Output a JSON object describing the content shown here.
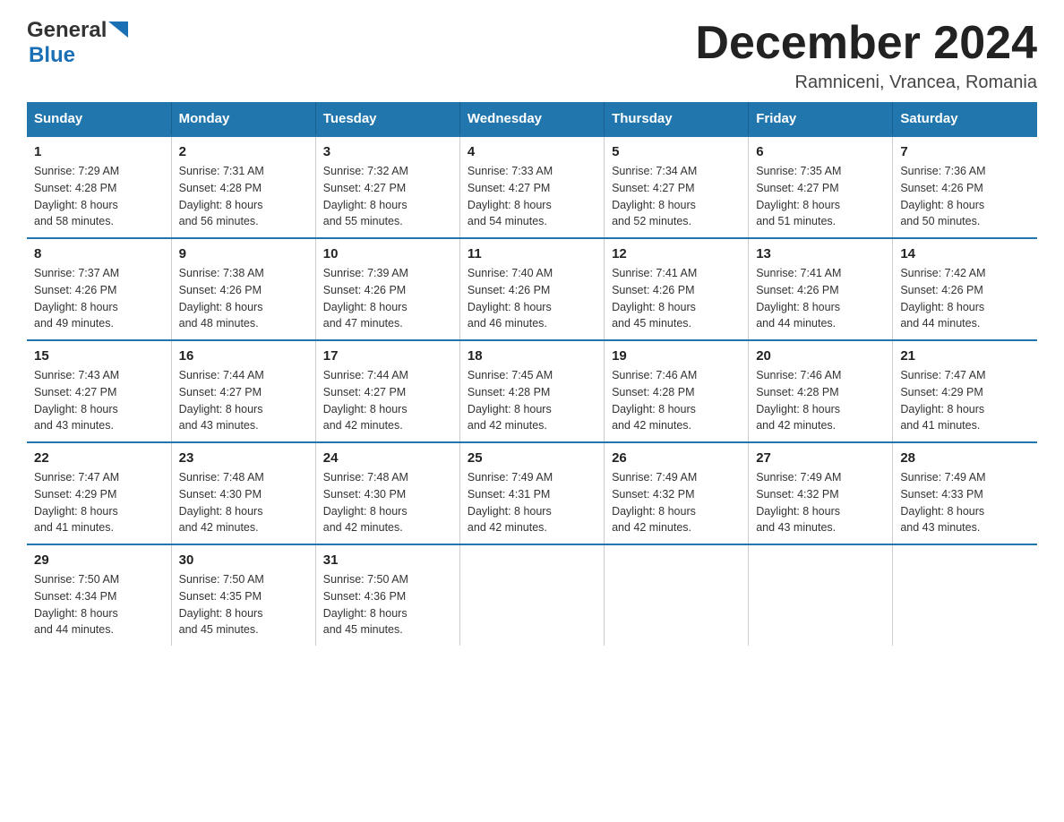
{
  "header": {
    "logo_general": "General",
    "logo_blue": "Blue",
    "title": "December 2024",
    "subtitle": "Ramniceni, Vrancea, Romania"
  },
  "days_of_week": [
    "Sunday",
    "Monday",
    "Tuesday",
    "Wednesday",
    "Thursday",
    "Friday",
    "Saturday"
  ],
  "weeks": [
    [
      {
        "day": "1",
        "sunrise": "7:29 AM",
        "sunset": "4:28 PM",
        "daylight": "8 hours and 58 minutes."
      },
      {
        "day": "2",
        "sunrise": "7:31 AM",
        "sunset": "4:28 PM",
        "daylight": "8 hours and 56 minutes."
      },
      {
        "day": "3",
        "sunrise": "7:32 AM",
        "sunset": "4:27 PM",
        "daylight": "8 hours and 55 minutes."
      },
      {
        "day": "4",
        "sunrise": "7:33 AM",
        "sunset": "4:27 PM",
        "daylight": "8 hours and 54 minutes."
      },
      {
        "day": "5",
        "sunrise": "7:34 AM",
        "sunset": "4:27 PM",
        "daylight": "8 hours and 52 minutes."
      },
      {
        "day": "6",
        "sunrise": "7:35 AM",
        "sunset": "4:27 PM",
        "daylight": "8 hours and 51 minutes."
      },
      {
        "day": "7",
        "sunrise": "7:36 AM",
        "sunset": "4:26 PM",
        "daylight": "8 hours and 50 minutes."
      }
    ],
    [
      {
        "day": "8",
        "sunrise": "7:37 AM",
        "sunset": "4:26 PM",
        "daylight": "8 hours and 49 minutes."
      },
      {
        "day": "9",
        "sunrise": "7:38 AM",
        "sunset": "4:26 PM",
        "daylight": "8 hours and 48 minutes."
      },
      {
        "day": "10",
        "sunrise": "7:39 AM",
        "sunset": "4:26 PM",
        "daylight": "8 hours and 47 minutes."
      },
      {
        "day": "11",
        "sunrise": "7:40 AM",
        "sunset": "4:26 PM",
        "daylight": "8 hours and 46 minutes."
      },
      {
        "day": "12",
        "sunrise": "7:41 AM",
        "sunset": "4:26 PM",
        "daylight": "8 hours and 45 minutes."
      },
      {
        "day": "13",
        "sunrise": "7:41 AM",
        "sunset": "4:26 PM",
        "daylight": "8 hours and 44 minutes."
      },
      {
        "day": "14",
        "sunrise": "7:42 AM",
        "sunset": "4:26 PM",
        "daylight": "8 hours and 44 minutes."
      }
    ],
    [
      {
        "day": "15",
        "sunrise": "7:43 AM",
        "sunset": "4:27 PM",
        "daylight": "8 hours and 43 minutes."
      },
      {
        "day": "16",
        "sunrise": "7:44 AM",
        "sunset": "4:27 PM",
        "daylight": "8 hours and 43 minutes."
      },
      {
        "day": "17",
        "sunrise": "7:44 AM",
        "sunset": "4:27 PM",
        "daylight": "8 hours and 42 minutes."
      },
      {
        "day": "18",
        "sunrise": "7:45 AM",
        "sunset": "4:28 PM",
        "daylight": "8 hours and 42 minutes."
      },
      {
        "day": "19",
        "sunrise": "7:46 AM",
        "sunset": "4:28 PM",
        "daylight": "8 hours and 42 minutes."
      },
      {
        "day": "20",
        "sunrise": "7:46 AM",
        "sunset": "4:28 PM",
        "daylight": "8 hours and 42 minutes."
      },
      {
        "day": "21",
        "sunrise": "7:47 AM",
        "sunset": "4:29 PM",
        "daylight": "8 hours and 41 minutes."
      }
    ],
    [
      {
        "day": "22",
        "sunrise": "7:47 AM",
        "sunset": "4:29 PM",
        "daylight": "8 hours and 41 minutes."
      },
      {
        "day": "23",
        "sunrise": "7:48 AM",
        "sunset": "4:30 PM",
        "daylight": "8 hours and 42 minutes."
      },
      {
        "day": "24",
        "sunrise": "7:48 AM",
        "sunset": "4:30 PM",
        "daylight": "8 hours and 42 minutes."
      },
      {
        "day": "25",
        "sunrise": "7:49 AM",
        "sunset": "4:31 PM",
        "daylight": "8 hours and 42 minutes."
      },
      {
        "day": "26",
        "sunrise": "7:49 AM",
        "sunset": "4:32 PM",
        "daylight": "8 hours and 42 minutes."
      },
      {
        "day": "27",
        "sunrise": "7:49 AM",
        "sunset": "4:32 PM",
        "daylight": "8 hours and 43 minutes."
      },
      {
        "day": "28",
        "sunrise": "7:49 AM",
        "sunset": "4:33 PM",
        "daylight": "8 hours and 43 minutes."
      }
    ],
    [
      {
        "day": "29",
        "sunrise": "7:50 AM",
        "sunset": "4:34 PM",
        "daylight": "8 hours and 44 minutes."
      },
      {
        "day": "30",
        "sunrise": "7:50 AM",
        "sunset": "4:35 PM",
        "daylight": "8 hours and 45 minutes."
      },
      {
        "day": "31",
        "sunrise": "7:50 AM",
        "sunset": "4:36 PM",
        "daylight": "8 hours and 45 minutes."
      },
      null,
      null,
      null,
      null
    ]
  ],
  "labels": {
    "sunrise": "Sunrise:",
    "sunset": "Sunset:",
    "daylight": "Daylight:"
  }
}
